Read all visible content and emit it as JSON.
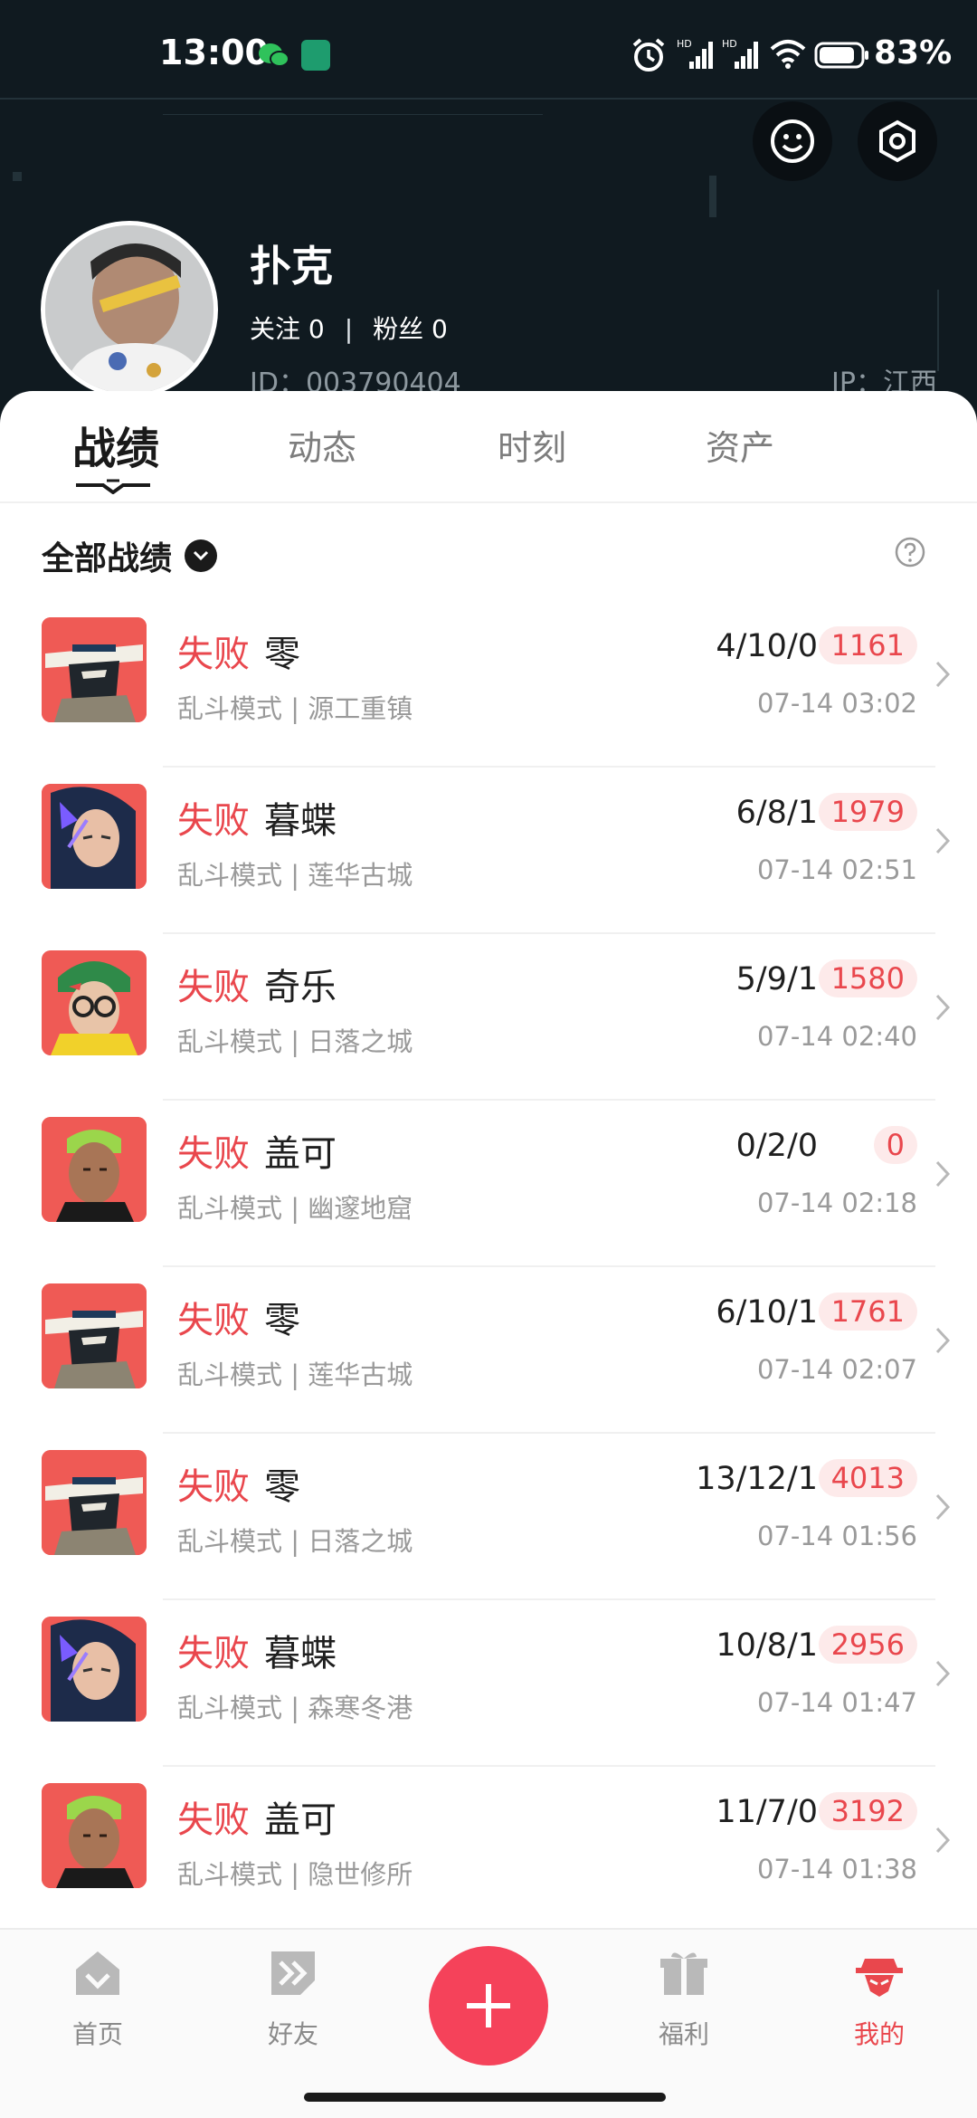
{
  "status_bar": {
    "time": "13:00",
    "battery": "83%"
  },
  "profile": {
    "username": "扑克",
    "follow_label": "关注 0",
    "fans_label": "粉丝 0",
    "id_label": "ID：003790404",
    "ip_label": "IP：江西"
  },
  "tabs": [
    "战绩",
    "动态",
    "时刻",
    "资产"
  ],
  "filter": {
    "label": "全部战绩"
  },
  "matches": [
    {
      "result": "失败",
      "agent": "零",
      "mode": "乱斗模式 | 源工重镇",
      "kda": "4/10/0",
      "score": "1161",
      "time": "07-14 03:02",
      "avatar": "cypher"
    },
    {
      "result": "失败",
      "agent": "暮蝶",
      "mode": "乱斗模式 | 莲华古城",
      "kda": "6/8/1",
      "score": "1979",
      "time": "07-14 02:51",
      "avatar": "neon"
    },
    {
      "result": "失败",
      "agent": "奇乐",
      "mode": "乱斗模式 | 日落之城",
      "kda": "5/9/1",
      "score": "1580",
      "time": "07-14 02:40",
      "avatar": "killjoy"
    },
    {
      "result": "失败",
      "agent": "盖可",
      "mode": "乱斗模式 | 幽邃地窟",
      "kda": "0/2/0",
      "score": "0",
      "time": "07-14 02:18",
      "avatar": "gekko"
    },
    {
      "result": "失败",
      "agent": "零",
      "mode": "乱斗模式 | 莲华古城",
      "kda": "6/10/1",
      "score": "1761",
      "time": "07-14 02:07",
      "avatar": "cypher"
    },
    {
      "result": "失败",
      "agent": "零",
      "mode": "乱斗模式 | 日落之城",
      "kda": "13/12/1",
      "score": "4013",
      "time": "07-14 01:56",
      "avatar": "cypher"
    },
    {
      "result": "失败",
      "agent": "暮蝶",
      "mode": "乱斗模式 | 森寒冬港",
      "kda": "10/8/1",
      "score": "2956",
      "time": "07-14 01:47",
      "avatar": "neon"
    },
    {
      "result": "失败",
      "agent": "盖可",
      "mode": "乱斗模式 | 隐世修所",
      "kda": "11/7/0",
      "score": "3192",
      "time": "07-14 01:38",
      "avatar": "gekko"
    }
  ],
  "nav": [
    "首页",
    "好友",
    "福利",
    "我的"
  ],
  "colors": {
    "accent": "#e9474d",
    "header_bg": "#101a20",
    "add_button": "#f5425a"
  }
}
